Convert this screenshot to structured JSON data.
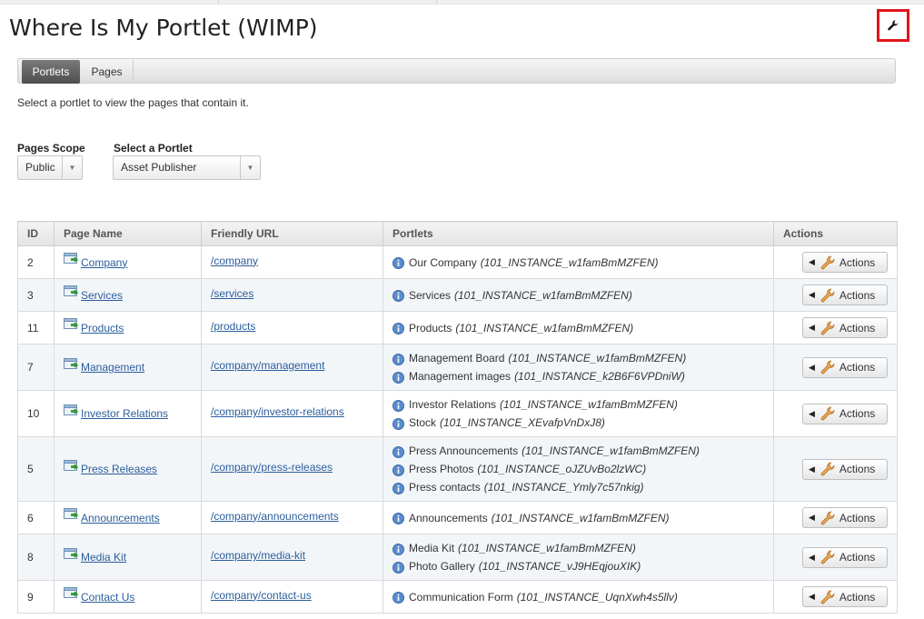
{
  "page": {
    "title": "Where Is My Portlet (WIMP)",
    "config_icon": "wrench-icon"
  },
  "tabs": [
    {
      "label": "Portlets",
      "active": true
    },
    {
      "label": "Pages",
      "active": false
    }
  ],
  "hint": "Select a portlet to view the pages that contain it.",
  "filters": {
    "scope_label": "Pages Scope",
    "scope_value": "Public",
    "portlet_label": "Select a Portlet",
    "portlet_value": "Asset Publisher"
  },
  "table": {
    "headers": [
      "ID",
      "Page Name",
      "Friendly URL",
      "Portlets",
      "Actions"
    ],
    "action_label": "Actions",
    "rows": [
      {
        "id": "2",
        "name": "Company",
        "url": "/company",
        "portlets": [
          {
            "name": "Our Company",
            "instance": "(101_INSTANCE_w1famBmMZFEN)"
          }
        ]
      },
      {
        "id": "3",
        "name": "Services",
        "url": "/services",
        "portlets": [
          {
            "name": "Services",
            "instance": "(101_INSTANCE_w1famBmMZFEN)"
          }
        ]
      },
      {
        "id": "11",
        "name": "Products",
        "url": "/products",
        "portlets": [
          {
            "name": "Products",
            "instance": "(101_INSTANCE_w1famBmMZFEN)"
          }
        ]
      },
      {
        "id": "7",
        "name": "Management",
        "url": "/company/management",
        "portlets": [
          {
            "name": "Management Board",
            "instance": "(101_INSTANCE_w1famBmMZFEN)"
          },
          {
            "name": "Management images",
            "instance": "(101_INSTANCE_k2B6F6VPDniW)"
          }
        ]
      },
      {
        "id": "10",
        "name": "Investor Relations",
        "url": "/company/investor-relations",
        "portlets": [
          {
            "name": "Investor Relations",
            "instance": "(101_INSTANCE_w1famBmMZFEN)"
          },
          {
            "name": "Stock",
            "instance": "(101_INSTANCE_XEvafpVnDxJ8)"
          }
        ]
      },
      {
        "id": "5",
        "name": "Press Releases",
        "url": "/company/press-releases",
        "portlets": [
          {
            "name": "Press Announcements",
            "instance": "(101_INSTANCE_w1famBmMZFEN)"
          },
          {
            "name": "Press Photos",
            "instance": "(101_INSTANCE_oJZUvBo2lzWC)"
          },
          {
            "name": "Press contacts",
            "instance": "(101_INSTANCE_Ymly7c57nkig)"
          }
        ]
      },
      {
        "id": "6",
        "name": "Announcements",
        "url": "/company/announcements",
        "portlets": [
          {
            "name": "Announcements",
            "instance": "(101_INSTANCE_w1famBmMZFEN)"
          }
        ]
      },
      {
        "id": "8",
        "name": "Media Kit",
        "url": "/company/media-kit",
        "portlets": [
          {
            "name": "Media Kit",
            "instance": "(101_INSTANCE_w1famBmMZFEN)"
          },
          {
            "name": "Photo Gallery",
            "instance": "(101_INSTANCE_vJ9HEqjouXIK)"
          }
        ]
      },
      {
        "id": "9",
        "name": "Contact Us",
        "url": "/company/contact-us",
        "portlets": [
          {
            "name": "Communication Form",
            "instance": "(101_INSTANCE_UqnXwh4s5llv)"
          }
        ]
      }
    ]
  },
  "colors": {
    "link": "#2a5e9c",
    "highlight_border": "#e0161e",
    "active_tab": "#5a5a5a",
    "alt_row": "#f3f6f9"
  }
}
